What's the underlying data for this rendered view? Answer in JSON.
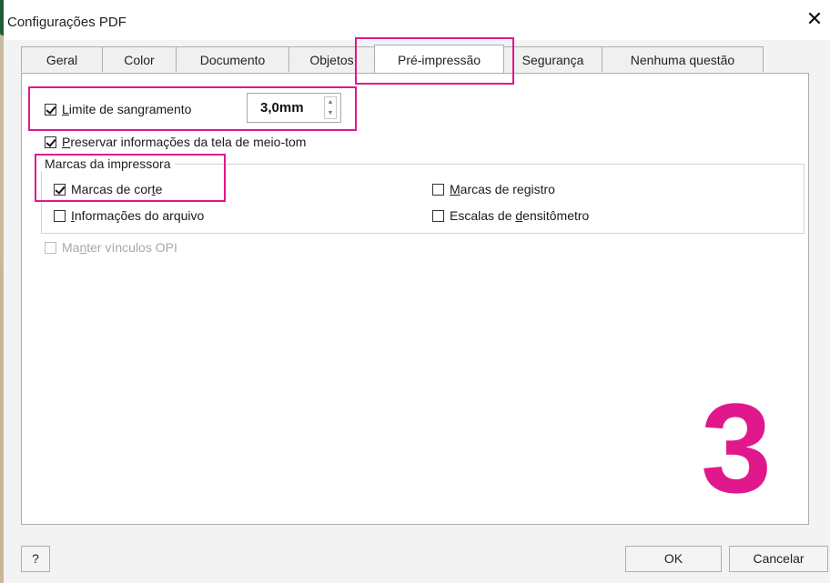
{
  "dialog": {
    "title": "Configurações PDF",
    "close_icon": "close-icon"
  },
  "tabs": [
    {
      "label": "Geral",
      "active": false
    },
    {
      "label": "Color",
      "active": false
    },
    {
      "label": "Documento",
      "active": false
    },
    {
      "label": "Objetos",
      "active": false
    },
    {
      "label": "Pré-impressão",
      "active": true
    },
    {
      "label": "Segurança",
      "active": false
    },
    {
      "label": "Nenhuma questão",
      "active": false
    }
  ],
  "bleed": {
    "checkbox_label_underline": "L",
    "checkbox_label_rest": "imite de sangramento",
    "checked": true,
    "value": "3,0mm"
  },
  "halftone": {
    "label_underline": "P",
    "label_rest": "reservar informações da tela de meio-tom",
    "checked": true
  },
  "printer_marks": {
    "group_label": "Marcas da impressora",
    "crop_marks": {
      "before": "Marcas de cor",
      "underline": "t",
      "after": "e",
      "checked": true
    },
    "file_info": {
      "underline": "I",
      "rest": "nformações do arquivo",
      "checked": false
    },
    "registration_marks": {
      "underline": "M",
      "rest": "arcas de registro",
      "checked": false
    },
    "densitometer": {
      "before": "Escalas de ",
      "underline": "d",
      "after": "ensitômetro",
      "checked": false
    }
  },
  "opi": {
    "before": "Ma",
    "underline": "n",
    "after": "ter vínculos OPI",
    "checked": false,
    "disabled": true
  },
  "annotation": {
    "step_number": "3",
    "color": "#e0188c"
  },
  "buttons": {
    "help": "?",
    "ok": "OK",
    "cancel": "Cancelar"
  }
}
